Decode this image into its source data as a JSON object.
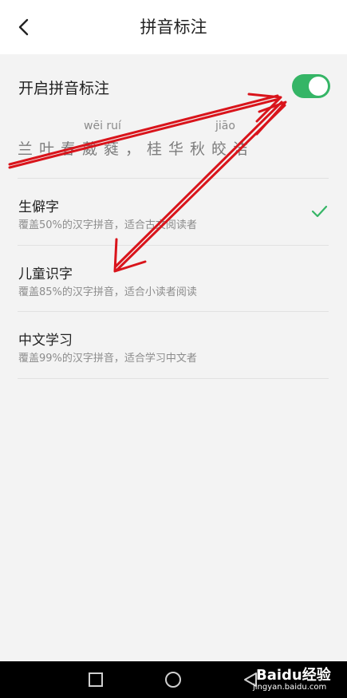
{
  "header": {
    "title": "拼音标注",
    "back_icon": "chevron-left-icon"
  },
  "toggle": {
    "label": "开启拼音标注",
    "state": "on",
    "color": "#35b566"
  },
  "preview": {
    "pinyin_1": "wēi ruí",
    "pinyin_2": "jiāo",
    "text": "兰叶春葳蕤，桂华秋皎洁"
  },
  "options": [
    {
      "title": "生僻字",
      "description": "覆盖50%的汉字拼音，适合古文阅读者",
      "selected": true
    },
    {
      "title": "儿童识字",
      "description": "覆盖85%的汉字拼音，适合小读者阅读",
      "selected": false
    },
    {
      "title": "中文学习",
      "description": "覆盖99%的汉字拼音，适合学习中文者",
      "selected": false
    }
  ],
  "navbar": {
    "icons": [
      "square-icon",
      "circle-icon",
      "triangle-back-icon"
    ]
  },
  "watermark": {
    "brand": "Baidu经验",
    "url": "jingyan.baidu.com"
  },
  "colors": {
    "accent": "#35b566",
    "annotation_arrow": "#d9141b"
  }
}
